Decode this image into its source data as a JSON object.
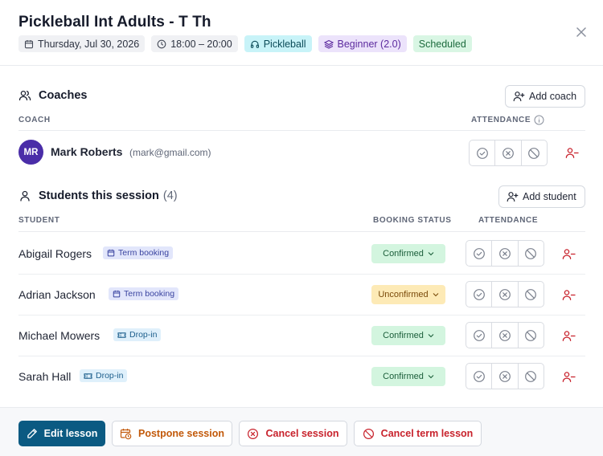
{
  "modal": {
    "title": "Pickleball Int Adults - T Th",
    "chips": {
      "date": "Thursday, Jul 30, 2026",
      "time": "18:00 – 20:00",
      "sport": "Pickleball",
      "level": "Beginner (2.0)",
      "status": "Scheduled"
    }
  },
  "coaches": {
    "heading": "Coaches",
    "add_label": "Add coach",
    "col_coach": "COACH",
    "col_attendance": "ATTENDANCE",
    "items": [
      {
        "initials": "MR",
        "name": "Mark Roberts",
        "email": "(mark@gmail.com)"
      }
    ]
  },
  "students": {
    "heading": "Students this session",
    "count": "(4)",
    "add_label": "Add student",
    "col_student": "STUDENT",
    "col_booking": "BOOKING STATUS",
    "col_attendance": "ATTENDANCE",
    "rows": [
      {
        "name": "Abigail Rogers",
        "tag": "Term booking",
        "status": "Confirmed"
      },
      {
        "name": "Adrian Jackson",
        "tag": "Term booking",
        "status": "Unconfirmed"
      },
      {
        "name": "Michael Mowers",
        "tag": "Drop-in",
        "status": "Confirmed"
      },
      {
        "name": "Sarah Hall",
        "tag": "Drop-in",
        "status": "Confirmed"
      }
    ]
  },
  "footer": {
    "edit": "Edit lesson",
    "postpone": "Postpone session",
    "cancel_session": "Cancel session",
    "cancel_term": "Cancel term lesson"
  },
  "colors": {
    "primary": "#0b5a82",
    "avatar": "#4a2da8",
    "danger": "#c8222c",
    "warning": "#c2590a"
  },
  "icons": [
    "calendar-icon",
    "clock-icon",
    "headphones-icon",
    "layers-icon",
    "close-icon",
    "users-icon",
    "user-icon",
    "user-plus-icon",
    "info-icon",
    "check-circle-icon",
    "x-circle-icon",
    "ban-icon",
    "user-minus-icon",
    "chevron-down-icon",
    "ticket-icon",
    "pencil-icon",
    "calendar-clock-icon"
  ]
}
